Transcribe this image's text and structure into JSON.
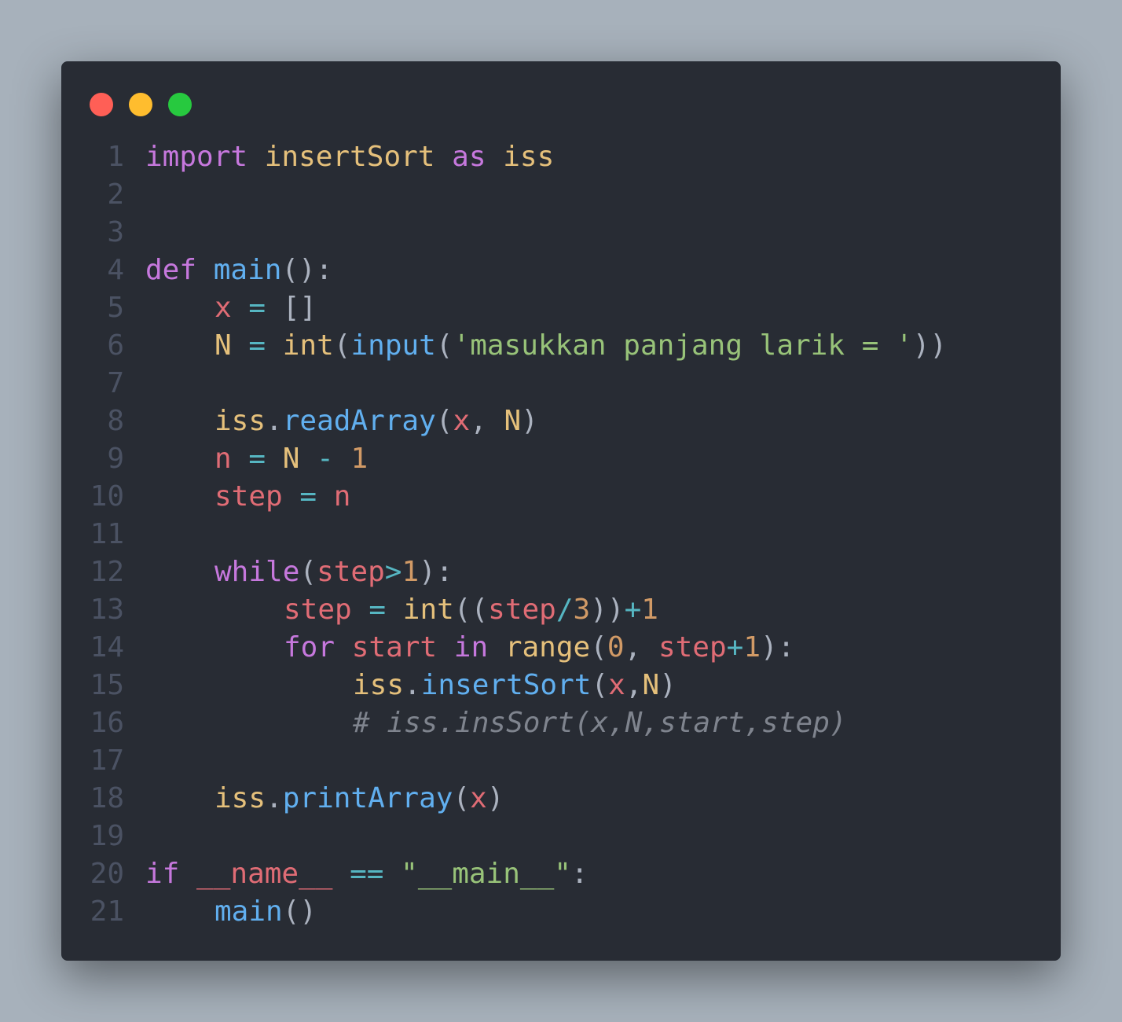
{
  "window": {
    "controls": [
      {
        "name": "close",
        "color": "#ff5f56"
      },
      {
        "name": "minimize",
        "color": "#ffbd2e"
      },
      {
        "name": "maximize",
        "color": "#27c93f"
      }
    ]
  },
  "colors": {
    "background": "#a7b1bb",
    "editor": "#282c34",
    "keyword": "#c678dd",
    "module": "#e5c07b",
    "function": "#61afef",
    "variable": "#e06c75",
    "number": "#d19a66",
    "string": "#98c379",
    "operator": "#56b6c2",
    "comment": "#7f848e",
    "line_number": "#4b5263"
  },
  "code": {
    "language": "python",
    "lines": [
      {
        "n": "1",
        "indent": 0,
        "tokens": [
          [
            "kw",
            "import"
          ],
          [
            "plain",
            " "
          ],
          [
            "mod",
            "insertSort"
          ],
          [
            "plain",
            " "
          ],
          [
            "kw",
            "as"
          ],
          [
            "plain",
            " "
          ],
          [
            "mod",
            "iss"
          ]
        ]
      },
      {
        "n": "2",
        "indent": 0,
        "tokens": []
      },
      {
        "n": "3",
        "indent": 0,
        "tokens": []
      },
      {
        "n": "4",
        "indent": 0,
        "tokens": [
          [
            "kw",
            "def"
          ],
          [
            "plain",
            " "
          ],
          [
            "fn",
            "main"
          ],
          [
            "punc",
            "():"
          ]
        ]
      },
      {
        "n": "5",
        "indent": 4,
        "tokens": [
          [
            "var",
            "x"
          ],
          [
            "plain",
            " "
          ],
          [
            "op",
            "="
          ],
          [
            "plain",
            " "
          ],
          [
            "punc",
            "[]"
          ]
        ]
      },
      {
        "n": "6",
        "indent": 4,
        "tokens": [
          [
            "mod",
            "N"
          ],
          [
            "plain",
            " "
          ],
          [
            "op",
            "="
          ],
          [
            "plain",
            " "
          ],
          [
            "mod",
            "int"
          ],
          [
            "punc",
            "("
          ],
          [
            "fn",
            "input"
          ],
          [
            "punc",
            "("
          ],
          [
            "str",
            "'masukkan panjang larik = '"
          ],
          [
            "punc",
            "))"
          ]
        ]
      },
      {
        "n": "7",
        "indent": 0,
        "tokens": []
      },
      {
        "n": "8",
        "indent": 4,
        "tokens": [
          [
            "mod",
            "iss"
          ],
          [
            "punc",
            "."
          ],
          [
            "fn",
            "readArray"
          ],
          [
            "punc",
            "("
          ],
          [
            "var",
            "x"
          ],
          [
            "punc",
            ", "
          ],
          [
            "mod",
            "N"
          ],
          [
            "punc",
            ")"
          ]
        ]
      },
      {
        "n": "9",
        "indent": 4,
        "tokens": [
          [
            "var",
            "n"
          ],
          [
            "plain",
            " "
          ],
          [
            "op",
            "="
          ],
          [
            "plain",
            " "
          ],
          [
            "mod",
            "N"
          ],
          [
            "plain",
            " "
          ],
          [
            "op",
            "-"
          ],
          [
            "plain",
            " "
          ],
          [
            "num",
            "1"
          ]
        ]
      },
      {
        "n": "10",
        "indent": 4,
        "tokens": [
          [
            "var",
            "step"
          ],
          [
            "plain",
            " "
          ],
          [
            "op",
            "="
          ],
          [
            "plain",
            " "
          ],
          [
            "var",
            "n"
          ]
        ]
      },
      {
        "n": "11",
        "indent": 0,
        "tokens": []
      },
      {
        "n": "12",
        "indent": 4,
        "tokens": [
          [
            "kw",
            "while"
          ],
          [
            "punc",
            "("
          ],
          [
            "var",
            "step"
          ],
          [
            "op",
            ">"
          ],
          [
            "num",
            "1"
          ],
          [
            "punc",
            "):"
          ]
        ]
      },
      {
        "n": "13",
        "indent": 8,
        "tokens": [
          [
            "var",
            "step"
          ],
          [
            "plain",
            " "
          ],
          [
            "op",
            "="
          ],
          [
            "plain",
            " "
          ],
          [
            "mod",
            "int"
          ],
          [
            "punc",
            "(("
          ],
          [
            "var",
            "step"
          ],
          [
            "op",
            "/"
          ],
          [
            "num",
            "3"
          ],
          [
            "punc",
            "))"
          ],
          [
            "op",
            "+"
          ],
          [
            "num",
            "1"
          ]
        ]
      },
      {
        "n": "14",
        "indent": 8,
        "tokens": [
          [
            "kw",
            "for"
          ],
          [
            "plain",
            " "
          ],
          [
            "var",
            "start"
          ],
          [
            "plain",
            " "
          ],
          [
            "kw",
            "in"
          ],
          [
            "plain",
            " "
          ],
          [
            "mod",
            "range"
          ],
          [
            "punc",
            "("
          ],
          [
            "num",
            "0"
          ],
          [
            "punc",
            ", "
          ],
          [
            "var",
            "step"
          ],
          [
            "op",
            "+"
          ],
          [
            "num",
            "1"
          ],
          [
            "punc",
            "):"
          ]
        ]
      },
      {
        "n": "15",
        "indent": 12,
        "tokens": [
          [
            "mod",
            "iss"
          ],
          [
            "punc",
            "."
          ],
          [
            "fn",
            "insertSort"
          ],
          [
            "punc",
            "("
          ],
          [
            "var",
            "x"
          ],
          [
            "punc",
            ","
          ],
          [
            "mod",
            "N"
          ],
          [
            "punc",
            ")"
          ]
        ]
      },
      {
        "n": "16",
        "indent": 12,
        "tokens": [
          [
            "cmt",
            "# iss.insSort(x,N,start,step)"
          ]
        ]
      },
      {
        "n": "17",
        "indent": 0,
        "tokens": []
      },
      {
        "n": "18",
        "indent": 4,
        "tokens": [
          [
            "mod",
            "iss"
          ],
          [
            "punc",
            "."
          ],
          [
            "fn",
            "printArray"
          ],
          [
            "punc",
            "("
          ],
          [
            "var",
            "x"
          ],
          [
            "punc",
            ")"
          ]
        ]
      },
      {
        "n": "19",
        "indent": 0,
        "tokens": []
      },
      {
        "n": "20",
        "indent": 0,
        "tokens": [
          [
            "kw",
            "if"
          ],
          [
            "plain",
            " "
          ],
          [
            "var",
            "__name__"
          ],
          [
            "plain",
            " "
          ],
          [
            "op",
            "=="
          ],
          [
            "plain",
            " "
          ],
          [
            "str",
            "\"__main__\""
          ],
          [
            "punc",
            ":"
          ]
        ]
      },
      {
        "n": "21",
        "indent": 4,
        "tokens": [
          [
            "fn",
            "main"
          ],
          [
            "punc",
            "()"
          ]
        ]
      }
    ]
  }
}
